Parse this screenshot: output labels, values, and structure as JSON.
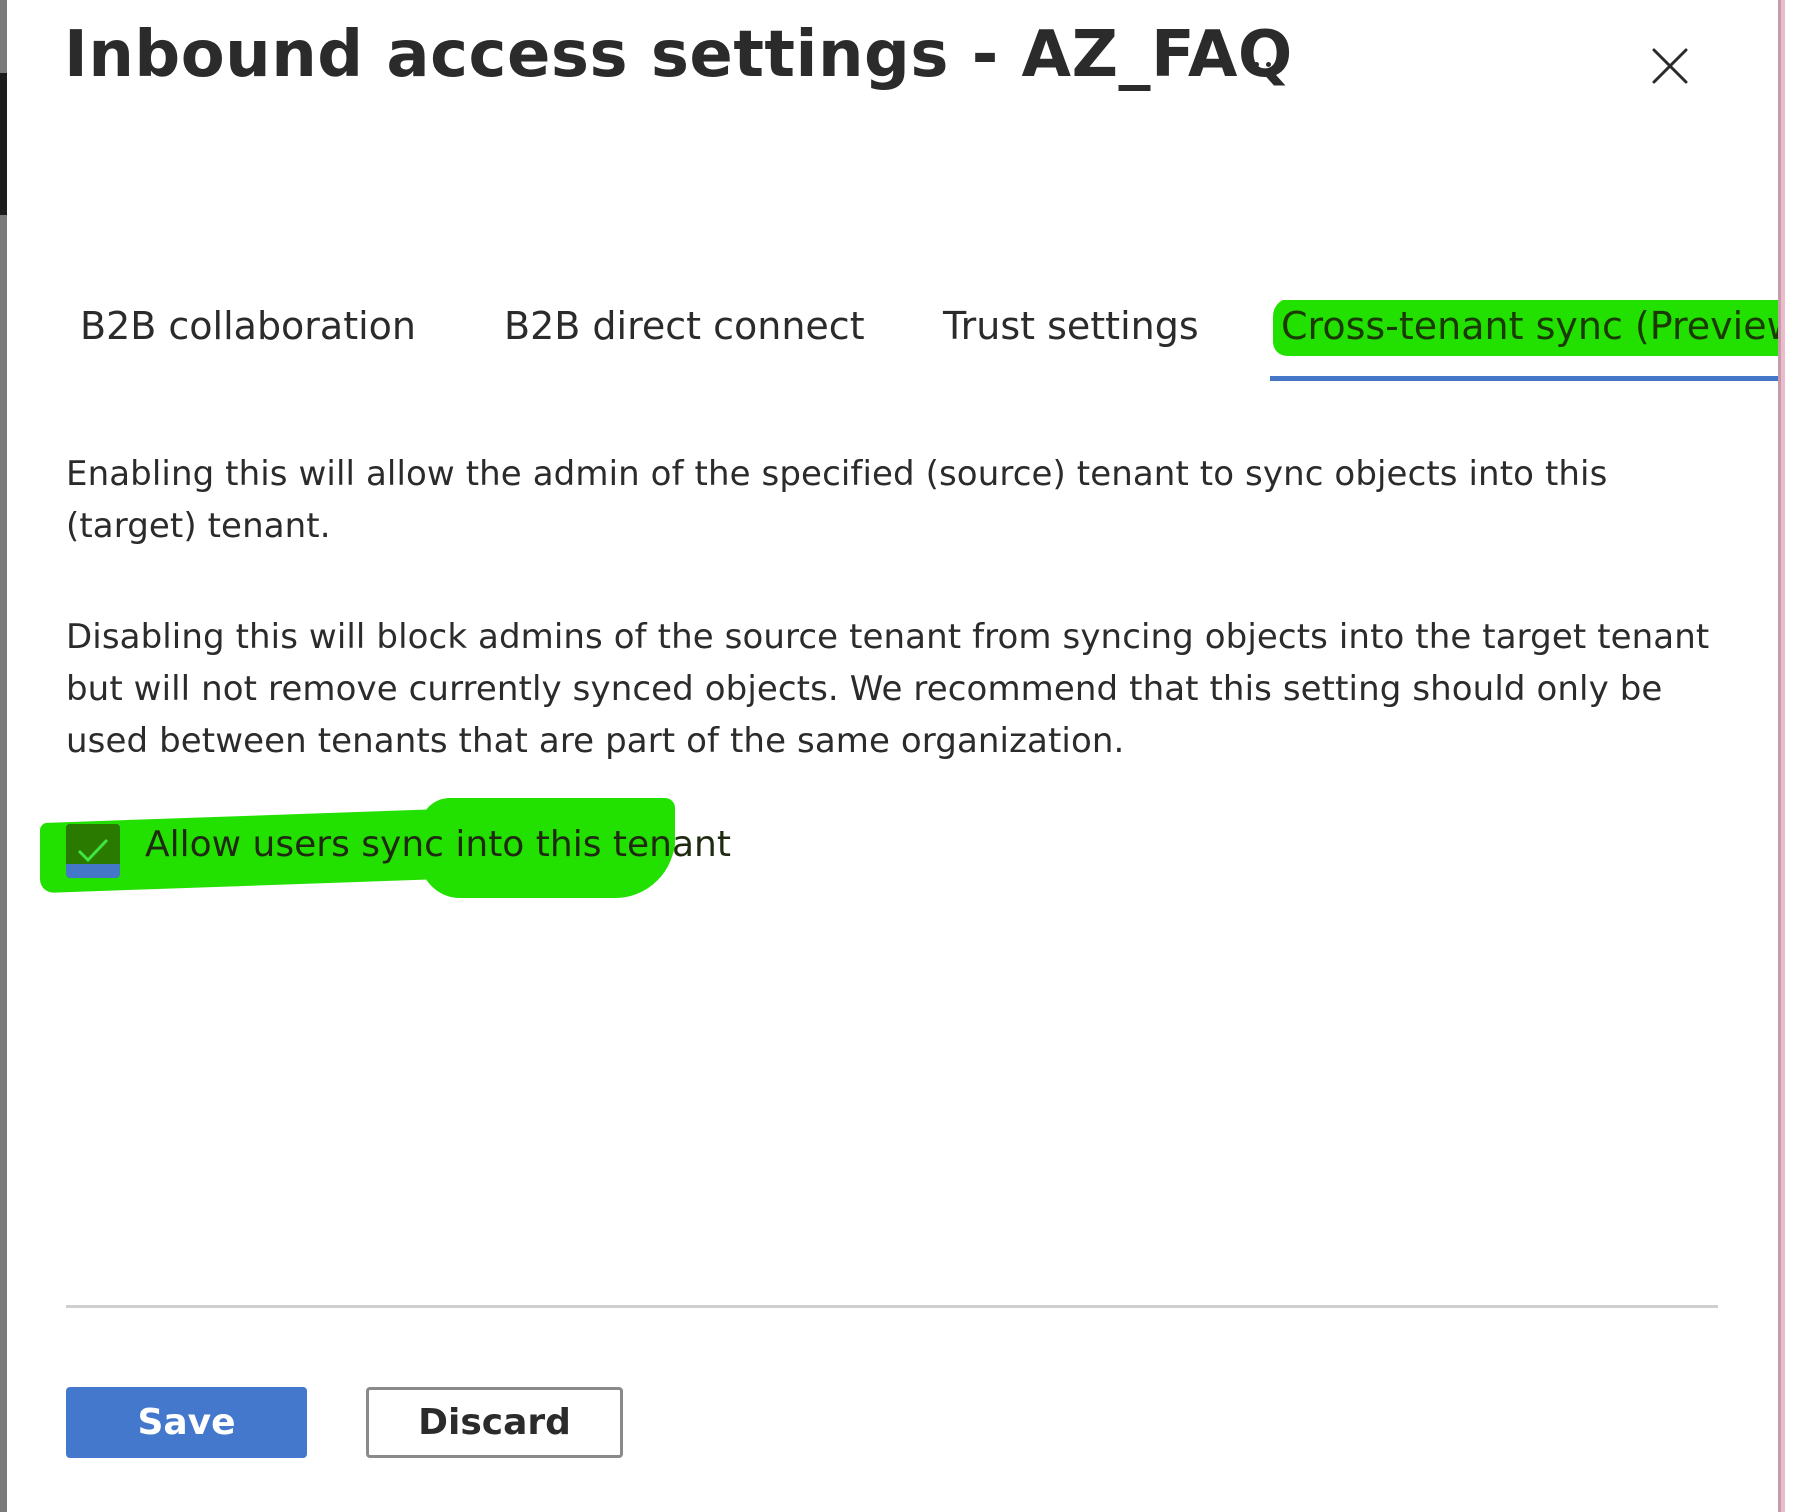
{
  "panel": {
    "title": "Inbound access settings - AZ_FAQ",
    "more_icon": "ellipsis-icon",
    "close_icon": "close-icon"
  },
  "tabs": [
    {
      "label": "B2B collaboration",
      "active": false
    },
    {
      "label": "B2B direct connect",
      "active": false
    },
    {
      "label": "Trust settings",
      "active": false
    },
    {
      "label": "Cross-tenant sync (Preview)",
      "active": true
    }
  ],
  "content": {
    "paragraph_1": "Enabling this will allow the admin of the specified (source) tenant to sync objects into this (target) tenant.",
    "paragraph_2": "Disabling this will block admins of the source tenant from syncing objects into the target tenant but will not remove currently synced objects. We recommend that this setting should only be used between tenants that are part of the same organization.",
    "checkbox": {
      "label": "Allow users sync into this tenant",
      "checked": true,
      "icon": "checkmark-icon"
    }
  },
  "footer": {
    "save_label": "Save",
    "discard_label": "Discard"
  },
  "colors": {
    "accent": "#4378cd",
    "highlighter": "#22e000",
    "text": "#2b2b2b"
  }
}
